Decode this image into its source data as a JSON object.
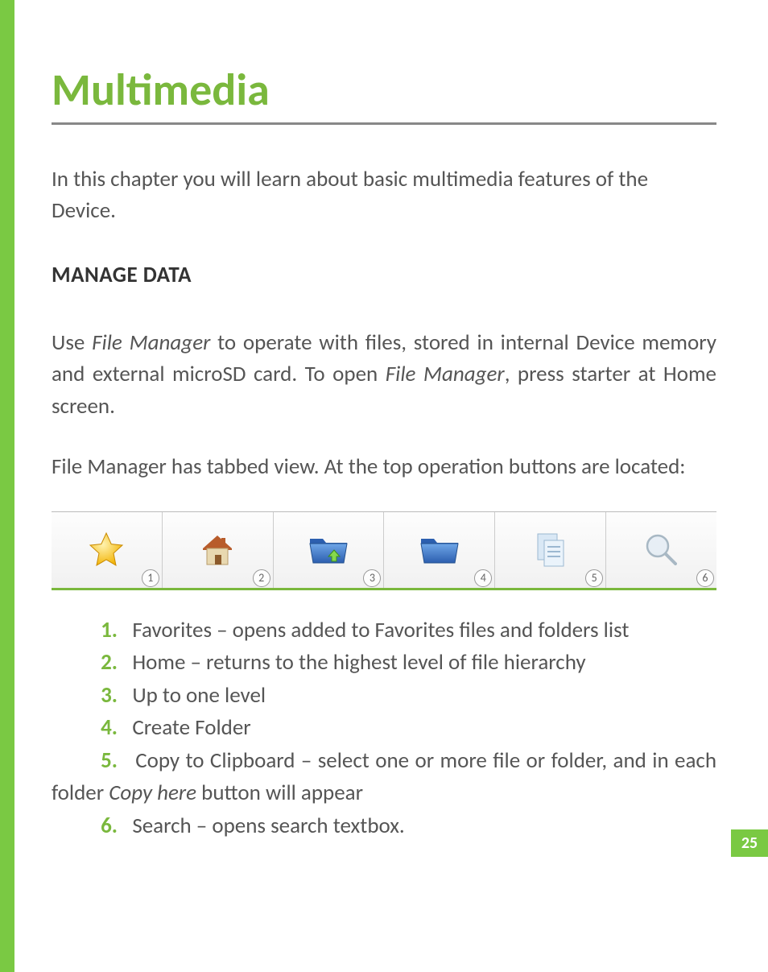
{
  "page": {
    "number": "25"
  },
  "title": "Multimedia",
  "intro": "In this chapter you will learn about basic multimedia features of the Device.",
  "heading2": "MANAGE DATA",
  "para1_pre": "Use ",
  "para1_em1": "File Manager",
  "para1_mid": " to operate with files, stored in internal Device memory and external microSD card. To open ",
  "para1_em2": "File Manager",
  "para1_post": ", press starter at Home screen.",
  "para2": "File Manager has tabbed view. At the top operation buttons are located:",
  "toolbar": {
    "badges": [
      "1",
      "2",
      "3",
      "4",
      "5",
      "6"
    ]
  },
  "list": {
    "n1": "1.",
    "t1": "Favorites – opens added to Favorites files and folders list",
    "n2": "2.",
    "t2": "Home – returns to the highest level of file hierarchy",
    "n3": "3.",
    "t3": "Up to one level",
    "n4": "4.",
    "t4": "Create Folder",
    "n5": "5.",
    "t5a": "Copy to Clipboard – select one or more file or folder, and in each folder ",
    "t5em": "Copy here",
    "t5b": " button will appear",
    "n6": "6.",
    "t6": "Search – opens search textbox."
  }
}
